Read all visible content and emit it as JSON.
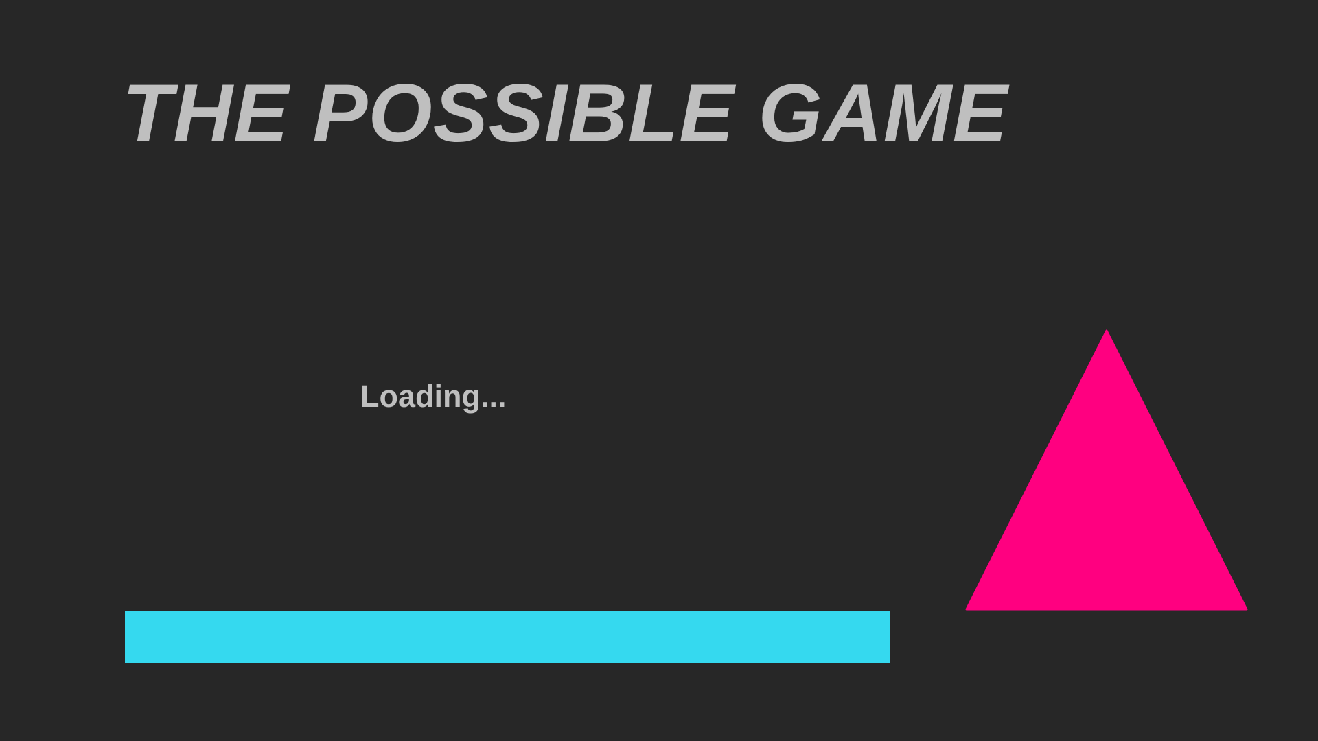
{
  "game": {
    "title": "THE POSSIBLE GAME",
    "loading_text": "Loading...",
    "loading_progress": 1.0
  },
  "colors": {
    "background": "#272727",
    "text": "#bfbfbf",
    "loading_bar": "#35d9ef",
    "player": "#ff0080"
  },
  "icons": {
    "player": "pink-triangle"
  }
}
